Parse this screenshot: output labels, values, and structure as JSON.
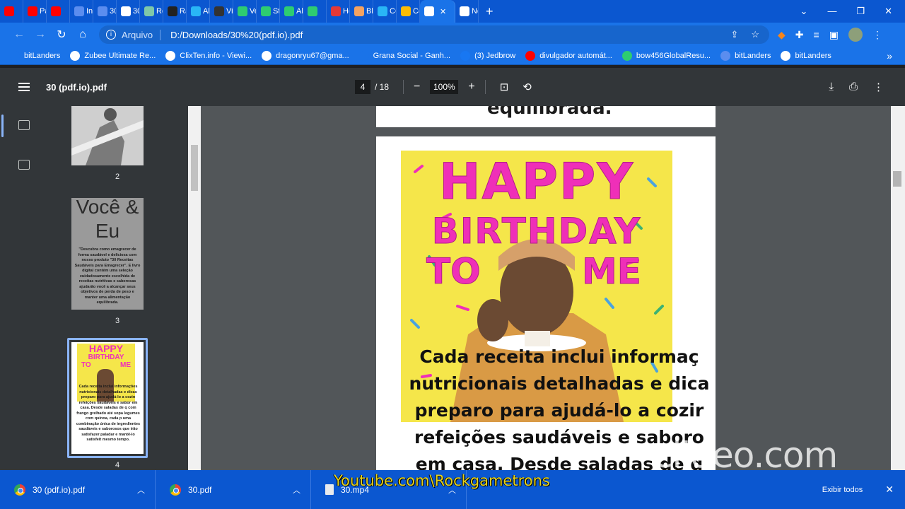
{
  "tabs": [
    {
      "label": "",
      "color": "#ff0000",
      "icon": "youtube-icon"
    },
    {
      "label": "Pai",
      "color": "#ff0000",
      "icon": "youtube-icon"
    },
    {
      "label": "",
      "color": "#ff0000",
      "icon": "youtube-icon"
    },
    {
      "label": "Ini",
      "color": "#5b8def",
      "icon": "site-icon"
    },
    {
      "label": "30",
      "color": "#5b8def",
      "icon": "site-icon"
    },
    {
      "label": "30",
      "color": "#ffffff",
      "icon": "site-icon"
    },
    {
      "label": "Re",
      "color": "#7fc8a9",
      "icon": "site-icon"
    },
    {
      "label": "Ra",
      "color": "#222222",
      "icon": "site-icon"
    },
    {
      "label": "Al",
      "color": "#29b6f6",
      "icon": "site-icon"
    },
    {
      "label": "Vis",
      "color": "#333333",
      "icon": "wix-icon"
    },
    {
      "label": "Ve",
      "color": "#2ecc71",
      "icon": "site-icon"
    },
    {
      "label": "Str",
      "color": "#2ecc71",
      "icon": "site-icon"
    },
    {
      "label": "All",
      "color": "#2ecc71",
      "icon": "play-icon"
    },
    {
      "label": "",
      "color": "#2ecc71",
      "icon": "play-icon"
    },
    {
      "label": "Ho",
      "color": "#e53935",
      "icon": "site-icon"
    },
    {
      "label": "Blo",
      "color": "#f4a261",
      "icon": "blogger-icon"
    },
    {
      "label": "CC",
      "color": "#29b6f6",
      "icon": "site-icon"
    },
    {
      "label": "Co",
      "color": "#fbbc04",
      "icon": "site-icon"
    },
    {
      "label": "",
      "color": "#ffffff",
      "icon": "chrome-icon",
      "active": true
    },
    {
      "label": "No",
      "color": "#ffffff",
      "icon": "site-icon"
    }
  ],
  "address": {
    "protocol": "Arquivo",
    "url": "D:/Downloads/30%20(pdf.io).pdf"
  },
  "bookmarks": [
    "bitLanders",
    "Zubee Ultimate Re...",
    "ClixTen.info - Viewi...",
    "dragonryu67@gma...",
    "Grana Social - Ganh...",
    "(3) Jedbrow",
    "divulgador automát...",
    "bow456GlobalResu...",
    "bitLanders",
    "bitLanders"
  ],
  "pdf": {
    "title": "30 (pdf.io).pdf",
    "current_page": "4",
    "total_pages": "/ 18",
    "zoom": "100%",
    "prev_page_tail": "equilibrada.",
    "gif_text": [
      "HAPPY",
      "BIRTHDAY",
      "TO",
      "ME"
    ],
    "body_lines": [
      "Cada receita inclui informaç",
      "nutricionais detalhadas e dica",
      "preparo para ajudá-lo a cozir",
      "refeições saudáveis e saboro",
      "em casa. Desde saladas de q"
    ]
  },
  "thumbnails": {
    "page2_label": "2",
    "page3_label": "3",
    "page4_label": "4",
    "page3_heading": "Você & Eu",
    "page3_small": "\"Descubra como emagrecer de forma saudável e deliciosa com nosso produto \"30 Receitas Saudáveis para Emagrecer\". E livro digital contém uma seleção cuidadosamente escolhida de receitas nutritivas e saborosas ajudarão você a alcançar seus objetivos de perda de peso e manter uma alimentação equilibrada.",
    "page4_gif": [
      "HAPPY",
      "BIRTHDAY",
      "TO",
      "ME"
    ],
    "page4_small": "Cada receita inclui informações nutricionais detalhadas e dicas preparo para ajudá-lo a cozin refeições saudáveis e sabor em casa. Desde saladas de q com frango grelhado até sopa legumes com quinoa, cada p uma combinação única de ingredientes saudáveis e saborosos que irão satisfazer paladar e mantê-lo satisfeit mesmo tempo."
  },
  "downloads": [
    {
      "name": "30 (pdf.io).pdf"
    },
    {
      "name": "30.pdf"
    },
    {
      "name": "30.mp4"
    }
  ],
  "downloads_show_all": "Exibir todos",
  "watermark": "clideo.com",
  "youtube_overlay": "Youtube.com\\Rockgametrons"
}
